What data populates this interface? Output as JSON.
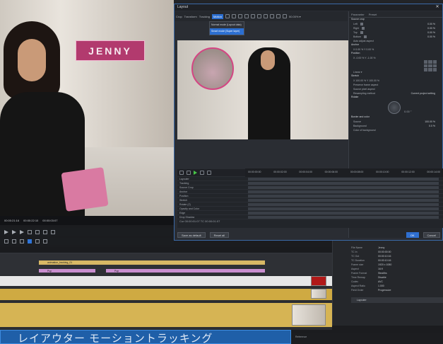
{
  "app": {
    "dialog_title": "Layout"
  },
  "left_preview": {
    "name_tag": "JENNY",
    "timecode_in": "00:00:21:16",
    "timecode_out": "00:00:22:10",
    "timecode_dur": "00:00:03:07"
  },
  "layout_dialog": {
    "toolbar_tabs": [
      "Crop",
      "Transform",
      "Tracking",
      "Motion"
    ],
    "mode_options": [
      "Normal mode (Layout data)",
      "Smart mode (Super layer)"
    ],
    "zoom": "50.00% ▾",
    "props": {
      "tabs": [
        "Parameter",
        "Preset"
      ],
      "source_crop_header": "Source crop",
      "crop_rows": [
        {
          "label": "Left",
          "value": "0.00 %"
        },
        {
          "label": "Right",
          "value": "0.00 %"
        },
        {
          "label": "Top",
          "value": "0.00 %"
        },
        {
          "label": "Bottom",
          "value": "0.00 %"
        }
      ],
      "auto_adjust": "Auto adjust aspect",
      "anchor_header": "Anchor",
      "anchor_value": "X  0.00 %   Y  0.00 %",
      "position_header": "Position",
      "position_value": "X  -0.00 %   Y  -1.00 %",
      "lock_aspect": "Linear  ▾",
      "stretch_header": "Stretch",
      "stretch_value": "X  100.00 %   Y  100.00 %",
      "preserve_aspect": "Preserve frame aspect",
      "source_pixel": "Source pixel aspect",
      "sampling_label": "Resampling method",
      "sampling_value": "Current project setting",
      "rotation_header": "Rotate",
      "rotation_value": "0.00 °",
      "border_header": "Border and color",
      "source_label": "Source",
      "source_value": "100.00 %",
      "background_label": "Background",
      "background_value": "0.0 %",
      "color_bg": "Color of background"
    },
    "timeline": {
      "timecodes": [
        "00:00:00:00",
        "00:00:02:00",
        "00:00:04:00",
        "00:00:06:00",
        "00:00:08:00",
        "00:00:10:00",
        "00:00:12:00",
        "00:00:14:00"
      ],
      "tracks": [
        "Layouter",
        "Tracking",
        "Source Crop",
        "Anchor",
        "Position",
        "Stretch",
        "Rotate (Z)",
        "Opacity and Color",
        "Edge",
        "Drop Shadow"
      ],
      "footer_tc": "Cur 00:00:01:07  TC 00:00:01:07"
    },
    "buttons": {
      "save_default": "Save as default",
      "reset_all": "Reset all",
      "ok": "OK",
      "cancel": "Cancel"
    }
  },
  "main_timeline": {
    "clips": [
      {
        "label": "animation_tracking_01",
        "color": "#d8b865"
      },
      {
        "label": "Pup",
        "color": "#c98ecf"
      },
      {
        "label": "Pop",
        "color": "#c98ecf"
      }
    ],
    "banner": "レイアウター モーショントラッキング"
  },
  "info_panel": {
    "rows": [
      {
        "k": "File Name",
        "v": "Jenny"
      },
      {
        "k": "TC In",
        "v": "00:00:00:00"
      },
      {
        "k": "TC Out",
        "v": "00:00:10:16"
      },
      {
        "k": "TC Duration",
        "v": "00:00:10:16"
      },
      {
        "k": "Frame size",
        "v": "1920 x 1080"
      },
      {
        "k": "Aspect",
        "v": "16:9"
      },
      {
        "k": "Frame Format",
        "v": "Stealths"
      },
      {
        "k": "Time Remap",
        "v": "Disable"
      },
      {
        "k": "Codec",
        "v": "AVC"
      },
      {
        "k": "Aspect Ratio",
        "v": "1.000"
      },
      {
        "k": "Field Order",
        "v": "Progressive"
      }
    ],
    "layer_label": "Layouter"
  },
  "status_bar": "Reference"
}
